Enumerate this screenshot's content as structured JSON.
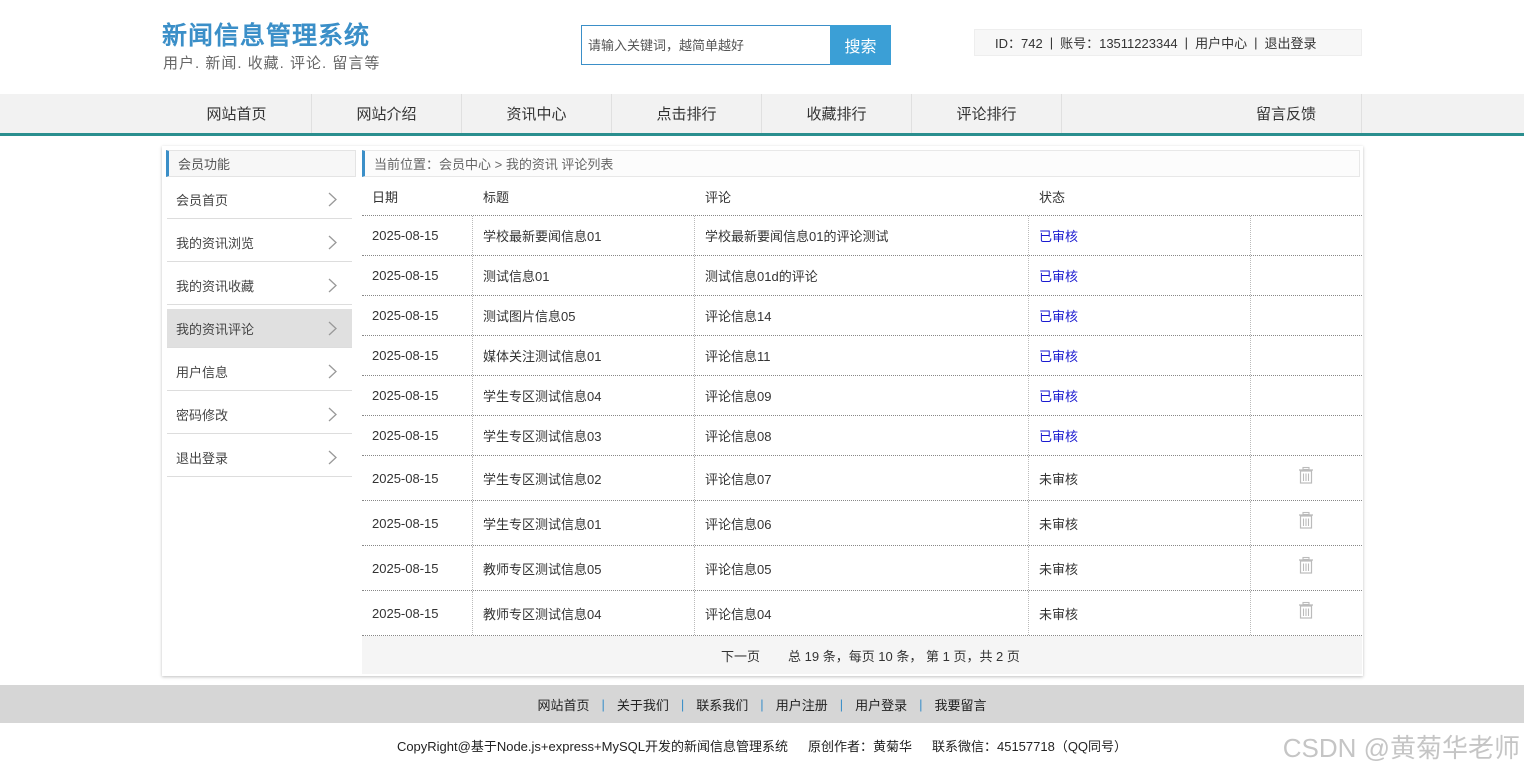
{
  "header": {
    "title": "新闻信息管理系统",
    "subtitle": "用户. 新闻. 收藏. 评论. 留言等",
    "search_placeholder": "请输入关键词，越简单越好",
    "search_button": "搜索",
    "user_id": "ID：742",
    "account": "账号：13511223344",
    "user_center": "用户中心",
    "logout": "退出登录",
    "separator": "|"
  },
  "nav": {
    "items": [
      "网站首页",
      "网站介绍",
      "资讯中心",
      "点击排行",
      "收藏排行",
      "评论排行",
      "留言反馈"
    ]
  },
  "sidebar": {
    "title": "会员功能",
    "items": [
      {
        "label": "会员首页",
        "active": false
      },
      {
        "label": "我的资讯浏览",
        "active": false
      },
      {
        "label": "我的资讯收藏",
        "active": false
      },
      {
        "label": "我的资讯评论",
        "active": true
      },
      {
        "label": "用户信息",
        "active": false
      },
      {
        "label": "密码修改",
        "active": false
      },
      {
        "label": "退出登录",
        "active": false
      }
    ]
  },
  "breadcrumb": "当前位置：会员中心 > 我的资讯 评论列表",
  "table": {
    "headers": [
      "日期",
      "标题",
      "评论",
      "状态"
    ],
    "rows": [
      {
        "date": "2025-08-15",
        "title": "学校最新要闻信息01",
        "comment": "学校最新要闻信息01的评论测试",
        "status": "已审核",
        "deletable": false
      },
      {
        "date": "2025-08-15",
        "title": "测试信息01",
        "comment": "测试信息01d的评论",
        "status": "已审核",
        "deletable": false
      },
      {
        "date": "2025-08-15",
        "title": "测试图片信息05",
        "comment": "评论信息14",
        "status": "已审核",
        "deletable": false
      },
      {
        "date": "2025-08-15",
        "title": "媒体关注测试信息01",
        "comment": "评论信息11",
        "status": "已审核",
        "deletable": false
      },
      {
        "date": "2025-08-15",
        "title": "学生专区测试信息04",
        "comment": "评论信息09",
        "status": "已审核",
        "deletable": false
      },
      {
        "date": "2025-08-15",
        "title": "学生专区测试信息03",
        "comment": "评论信息08",
        "status": "已审核",
        "deletable": false
      },
      {
        "date": "2025-08-15",
        "title": "学生专区测试信息02",
        "comment": "评论信息07",
        "status": "未审核",
        "deletable": true
      },
      {
        "date": "2025-08-15",
        "title": "学生专区测试信息01",
        "comment": "评论信息06",
        "status": "未审核",
        "deletable": true
      },
      {
        "date": "2025-08-15",
        "title": "教师专区测试信息05",
        "comment": "评论信息05",
        "status": "未审核",
        "deletable": true
      },
      {
        "date": "2025-08-15",
        "title": "教师专区测试信息04",
        "comment": "评论信息04",
        "status": "未审核",
        "deletable": true
      }
    ]
  },
  "pager": {
    "next": "下一页",
    "summary": "总 19 条，每页 10 条， 第 1 页，共 2 页"
  },
  "footer": {
    "links": [
      "网站首页",
      "关于我们",
      "联系我们",
      "用户注册",
      "用户登录",
      "我要留言"
    ],
    "separator": "|",
    "copyright": "CopyRight@基于Node.js+express+MySQL开发的新闻信息管理系统",
    "author": "原创作者：黄菊华",
    "contact": "联系微信：45157718（QQ同号）"
  },
  "watermark": "CSDN @黄菊华老师",
  "colors": {
    "accent": "#3b8fc8",
    "nav_border": "#2a8f8f",
    "approved": "#1a1ad0"
  }
}
